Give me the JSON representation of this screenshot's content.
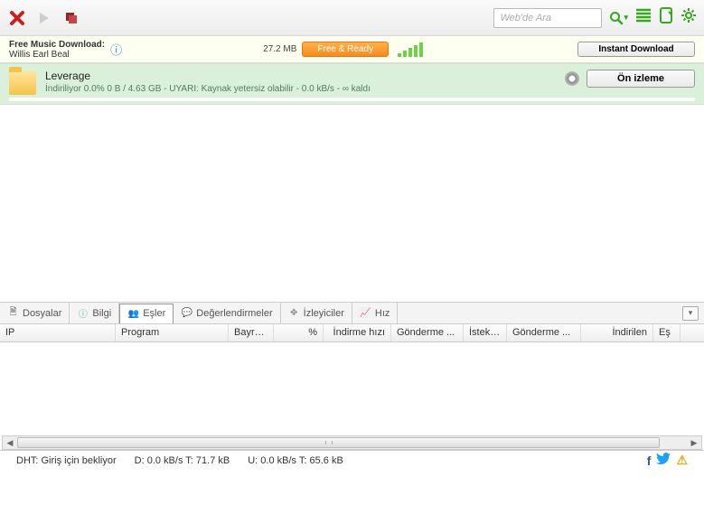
{
  "toolbar": {
    "search_placeholder": "Web'de Ara"
  },
  "musicbar": {
    "header": "Free Music Download:",
    "artist": "Willis Earl Beal",
    "size": "27.2 MB",
    "free_ready": "Free  & Ready",
    "instant_label": "Instant Download"
  },
  "download": {
    "name": "Leverage",
    "status": "İndiriliyor 0.0% 0 B / 4.63 GB - UYARI: Kaynak yetersiz olabilir - 0.0 kB/s - ∞ kaldı",
    "preview_label": "Ön izleme"
  },
  "tabs": {
    "files": "Dosyalar",
    "info": "Bilgi",
    "peers": "Eşler",
    "ratings": "Değerlendirmeler",
    "trackers": "İzleyiciler",
    "speed": "Hız"
  },
  "columns": {
    "ip": "IP",
    "program": "Program",
    "flag": "Bayra...",
    "pct": "%",
    "dlspeed": "İndirme hızı",
    "ulspeed": "Gönderme ...",
    "requests": "İstekler",
    "sent": "Gönderme ...",
    "downloaded": "İndirilen",
    "peer": "Eş"
  },
  "status": {
    "dht": "DHT: Giriş için bekliyor",
    "down": "D: 0.0 kB/s T: 71.7 kB",
    "up": "U: 0.0 kB/s T: 65.6 kB"
  }
}
